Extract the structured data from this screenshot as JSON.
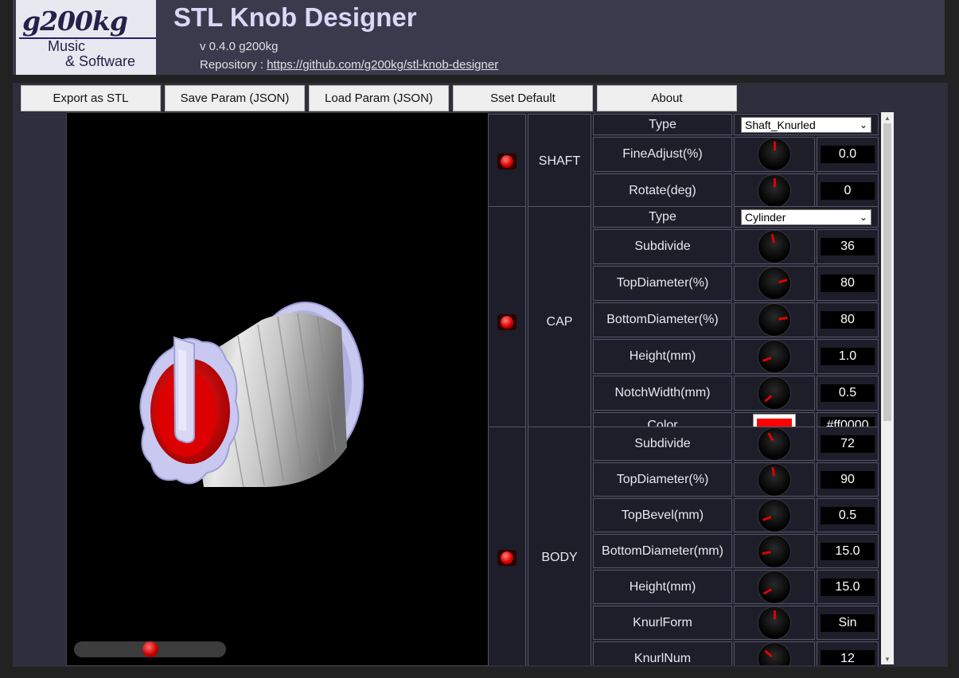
{
  "header": {
    "logo_main": "g200kg",
    "logo_sub1": "Music",
    "logo_sub2": "& Software",
    "title": "STL Knob Designer",
    "version": "v 0.4.0 g200kg",
    "repo_label": "Repository : ",
    "repo_url": "https://github.com/g200kg/stl-knob-designer"
  },
  "toolbar": [
    {
      "label": "Export as STL"
    },
    {
      "label": "Save Param (JSON)"
    },
    {
      "label": "Load Param (JSON)"
    },
    {
      "label": "Sset Default"
    },
    {
      "label": "About"
    }
  ],
  "viewer": {
    "rotation_slider_value": 0.5
  },
  "colors": {
    "accent_red": "#ff0000",
    "led_red": "#dd0000",
    "panel_bg": "#2e2e3c"
  },
  "params": {
    "shaft": {
      "label": "SHAFT",
      "type_label": "Type",
      "type_value": "Shaft_Knurled",
      "rows": [
        {
          "label": "FineAdjust(%)",
          "value": "0.0"
        },
        {
          "label": "Rotate(deg)",
          "value": "0"
        }
      ]
    },
    "cap": {
      "label": "CAP",
      "type_label": "Type",
      "type_value": "Cylinder",
      "rows": [
        {
          "label": "Subdivide",
          "value": "36"
        },
        {
          "label": "TopDiameter(%)",
          "value": "80"
        },
        {
          "label": "BottomDiameter(%)",
          "value": "80"
        },
        {
          "label": "Height(mm)",
          "value": "1.0"
        },
        {
          "label": "NotchWidth(mm)",
          "value": "0.5"
        }
      ],
      "color_label": "Color",
      "color_value": "#ff0000"
    },
    "body": {
      "label": "BODY",
      "rows": [
        {
          "label": "Subdivide",
          "value": "72"
        },
        {
          "label": "TopDiameter(%)",
          "value": "90"
        },
        {
          "label": "TopBevel(mm)",
          "value": "0.5"
        },
        {
          "label": "BottomDiameter(mm)",
          "value": "15.0"
        },
        {
          "label": "Height(mm)",
          "value": "15.0"
        },
        {
          "label": "KnurlForm",
          "value": "Sin"
        },
        {
          "label": "KnurlNum",
          "value": "12"
        }
      ]
    }
  }
}
